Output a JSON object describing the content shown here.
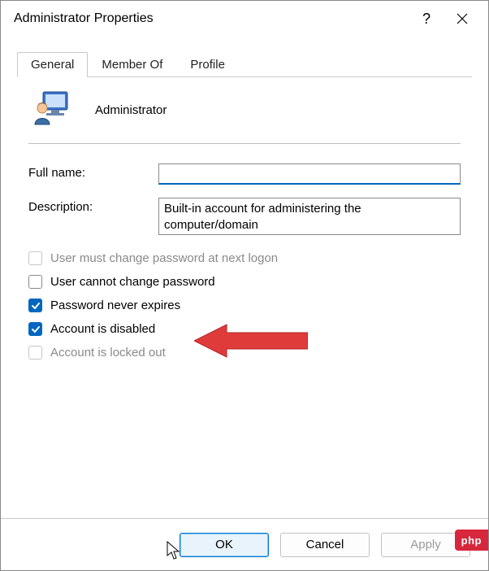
{
  "titlebar": {
    "title": "Administrator Properties",
    "help_symbol": "?"
  },
  "tabs": [
    {
      "label": "General",
      "active": true
    },
    {
      "label": "Member Of",
      "active": false
    },
    {
      "label": "Profile",
      "active": false
    }
  ],
  "identity": {
    "display_name": "Administrator"
  },
  "fields": {
    "full_name_label": "Full name:",
    "full_name_value": "",
    "description_label": "Description:",
    "description_value": "Built-in account for administering the computer/domain"
  },
  "checks": [
    {
      "label": "User must change password at next logon",
      "checked": false,
      "disabled": true
    },
    {
      "label": "User cannot change password",
      "checked": false,
      "disabled": false
    },
    {
      "label": "Password never expires",
      "checked": true,
      "disabled": false
    },
    {
      "label": "Account is disabled",
      "checked": true,
      "disabled": false
    },
    {
      "label": "Account is locked out",
      "checked": false,
      "disabled": true
    }
  ],
  "buttons": {
    "ok": "OK",
    "cancel": "Cancel",
    "apply": "Apply"
  },
  "watermark": "php",
  "colors": {
    "accent": "#0067c0",
    "arrow": "#e03b3b"
  }
}
